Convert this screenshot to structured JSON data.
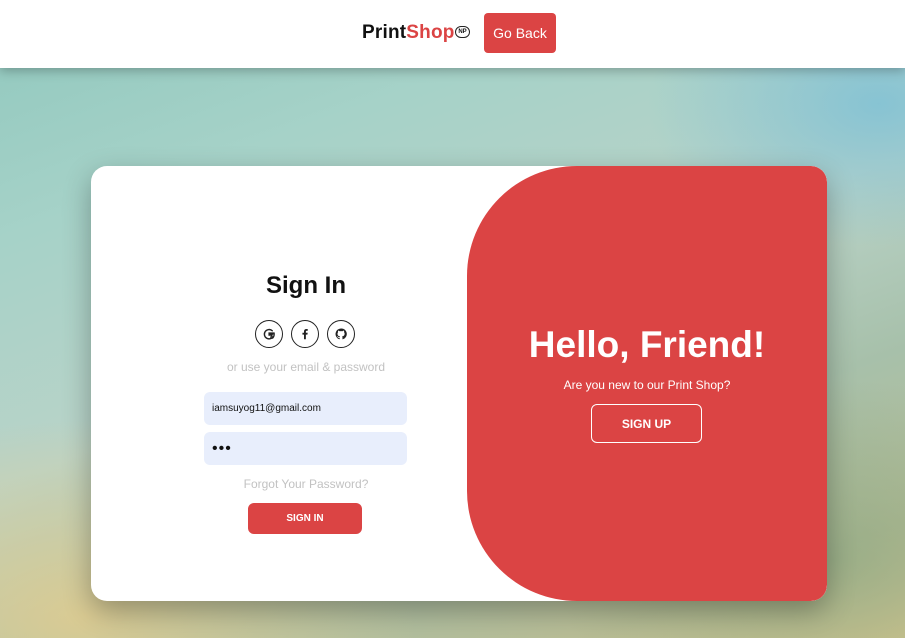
{
  "header": {
    "brand_print": "Print",
    "brand_shop": "Shop",
    "brand_badge": "NP",
    "go_back_label": "Go Back"
  },
  "signin": {
    "title": "Sign In",
    "socials": [
      {
        "icon": "google-icon",
        "glyph": "G"
      },
      {
        "icon": "facebook-icon",
        "glyph": "f"
      },
      {
        "icon": "github-icon"
      }
    ],
    "alt_text": "or use your email & password",
    "email_value": "iamsuyog11@gmail.com",
    "password_value": "•••",
    "forgot_label": "Forgot Your Password?",
    "button_label": "SIGN IN"
  },
  "overlay": {
    "title": "Hello, Friend!",
    "subtitle": "Are you new to our Print Shop?",
    "button_label": "SIGN UP"
  },
  "colors": {
    "accent": "#db4444",
    "field_bg": "#e8eefc",
    "muted_text": "#c2c2c2"
  }
}
